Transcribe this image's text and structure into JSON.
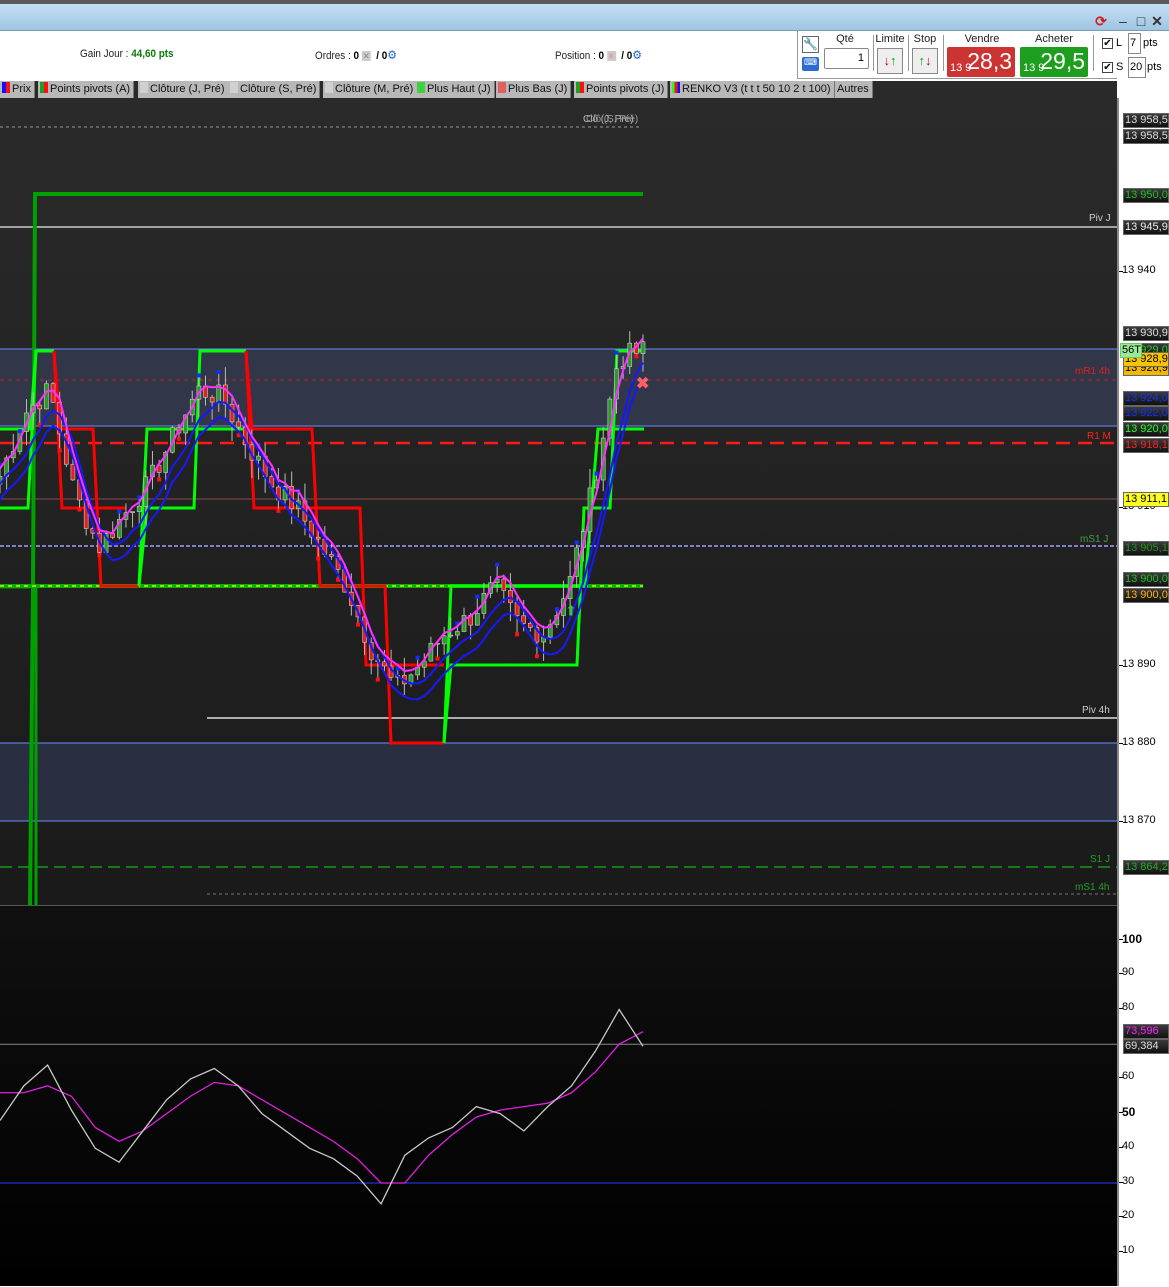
{
  "window": {
    "controls": [
      "refresh",
      "minimize",
      "maximize",
      "close"
    ]
  },
  "toolbar": {
    "gain_label": "Gain Jour :",
    "gain_value": "44,60 pts",
    "orders_label": "Ordres :",
    "orders_value": "0",
    "orders_sep": "/ 0",
    "position_label": "Position :",
    "position_value": "0",
    "position_sep": "/ 0"
  },
  "order_panel": {
    "qty_label": "Qté",
    "qty_value": "1",
    "limit_label": "Limite",
    "stop_label": "Stop",
    "sell_label": "Vendre",
    "sell_prefix": "13 9",
    "sell_price": "28,3",
    "buy_label": "Acheter",
    "buy_prefix": "13 9",
    "buy_price": "29,5",
    "l_label": "L",
    "l_value": "7",
    "s_label": "S",
    "s_value": "20",
    "pts": "pts",
    "l_checked": true,
    "s_checked": true,
    "sell_color": "#cc3333",
    "buy_color": "#1e9e1e"
  },
  "tabs": [
    {
      "label": "Prix",
      "colors": [
        "#1010ff",
        "#ff1010"
      ]
    },
    {
      "label": "Points pivots (A)",
      "colors": [
        "#20a020",
        "#ff1010"
      ]
    },
    {
      "label": "Clôture (J, Pré)",
      "colors": [
        "#d0d0d0"
      ]
    },
    {
      "label": "Clôture (S, Pré)",
      "colors": [
        "#d0d0d0"
      ]
    },
    {
      "label": "Clôture (M, Pré)",
      "colors": [
        "#d0d0d0"
      ]
    },
    {
      "label": "Plus Haut (J)",
      "colors": [
        "#40d040"
      ]
    },
    {
      "label": "Plus Bas (J)",
      "colors": [
        "#e06060"
      ]
    },
    {
      "label": "Points pivots (J)",
      "colors": [
        "#20a020",
        "#ff1010"
      ]
    },
    {
      "label": "RENKO V3 (t t t 50 10 2 t 100)",
      "colors": [
        "#20ff20",
        "#ff1010",
        "#1010ff"
      ]
    },
    {
      "label": "Autres",
      "colors": []
    }
  ],
  "line_labels": {
    "clo_j": "Clô (J, Pré)",
    "clo_s": "Clô (S, Pré)",
    "piv_j": "Piv J",
    "mr1_4h": "mR1 4h",
    "r1_m": "R1 M",
    "ms1_j": "mS1 J",
    "piv_4h": "Piv 4h",
    "s1_j": "S1 J",
    "ms1_4h": "mS1 4h"
  },
  "price_axis": {
    "ticks": [
      "13 940",
      "13 910",
      "13 890",
      "13 880",
      "13 870"
    ],
    "markers": {
      "clo_s": "13 958,5",
      "clo_j": "13 958,5",
      "high": "13 950,0",
      "piv_j": "13 945,9",
      "p1": "13 930,9",
      "tag": "56T",
      "p_hidden": "13 929,0",
      "p2": "13 928,9",
      "p3": "13 926,9",
      "b1": "13 924,0",
      "b2": "13 922,0",
      "g1": "13 920,0",
      "r1m": "13 918,1",
      "y1": "13 911,1",
      "ms1j": "13 905,1",
      "g2": "13 900,0",
      "o1": "13 900,0",
      "s1j": "13 864,2"
    }
  },
  "osc_axis": {
    "ticks": [
      "100",
      "90",
      "80",
      "60",
      "50",
      "40",
      "30",
      "20",
      "10"
    ],
    "markers": {
      "signal": "73,596",
      "main": "69,384"
    },
    "levels": [
      70,
      30
    ]
  },
  "chart_data": {
    "type": "candlestick",
    "price_path": [
      13914,
      13922,
      13925,
      13912,
      13905,
      13909,
      13913,
      13919,
      13925,
      13924,
      13918,
      13913,
      13910,
      13905,
      13900,
      13892,
      13887,
      13890,
      13894,
      13896,
      13900,
      13895,
      13894,
      13900,
      13913,
      13929,
      13930
    ],
    "osc_main": [
      48,
      58,
      64,
      51,
      40,
      36,
      45,
      54,
      60,
      63,
      58,
      50,
      45,
      40,
      37,
      32,
      24,
      38,
      43,
      46,
      52,
      50,
      45,
      52,
      58,
      68,
      80,
      69.4
    ],
    "osc_signal": [
      56,
      56,
      58,
      55,
      46,
      42,
      45,
      50,
      55,
      59,
      58,
      54,
      50,
      46,
      42,
      37,
      30,
      30,
      38,
      44,
      49,
      51,
      52,
      53,
      56,
      62,
      70,
      73.6
    ]
  }
}
